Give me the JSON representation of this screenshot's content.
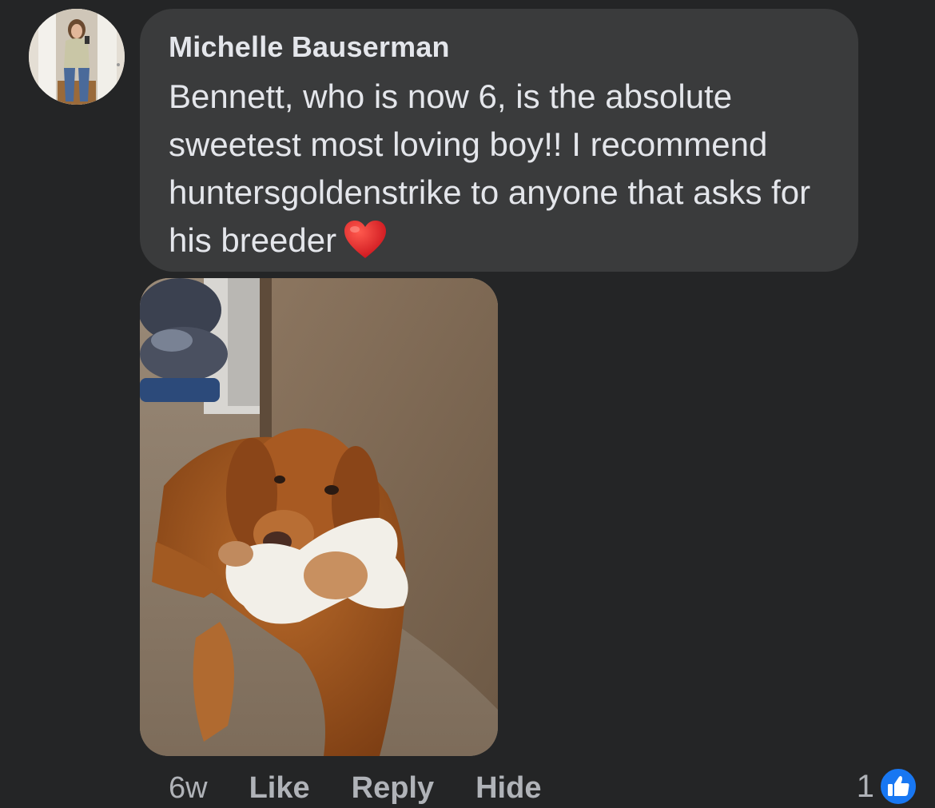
{
  "comment": {
    "author": "Michelle Bauserman",
    "text": "Bennett, who is now 6, is the absolute sweetest most loving boy!! I recommend huntersgoldenstrike to anyone that asks for his breeder",
    "emoji": "red-heart"
  },
  "meta": {
    "time": "6w",
    "like_label": "Like",
    "reply_label": "Reply",
    "hide_label": "Hide",
    "reaction_count": "1",
    "reaction_icon": "like-icon"
  },
  "colors": {
    "background": "#242526",
    "bubble": "#3a3b3c",
    "text": "#e4e6eb",
    "secondary_text": "#b0b3b8",
    "like_blue": "#1877f2"
  }
}
